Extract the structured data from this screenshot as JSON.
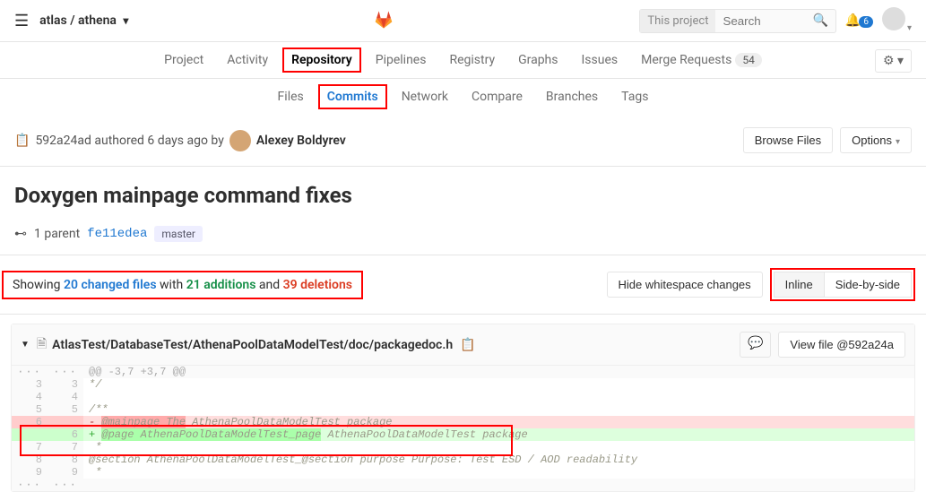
{
  "breadcrumb": {
    "group": "atlas",
    "project": "athena"
  },
  "search": {
    "scope": "This project",
    "placeholder": "Search"
  },
  "todos_count": "6",
  "nav1": {
    "project": "Project",
    "activity": "Activity",
    "repository": "Repository",
    "pipelines": "Pipelines",
    "registry": "Registry",
    "graphs": "Graphs",
    "issues": "Issues",
    "merge_requests": "Merge Requests",
    "mr_count": "54"
  },
  "nav2": {
    "files": "Files",
    "commits": "Commits",
    "network": "Network",
    "compare": "Compare",
    "branches": "Branches",
    "tags": "Tags"
  },
  "commit": {
    "sha": "592a24ad",
    "auth_text": "authored 6 days ago by",
    "author": "Alexey Boldyrev",
    "browse": "Browse Files",
    "options": "Options",
    "title": "Doxygen mainpage command fixes",
    "parents_label": "1 parent",
    "parent_sha": "fe11edea",
    "branch": "master"
  },
  "summary": {
    "prefix": "Showing",
    "changed": "20 changed files",
    "with": "with",
    "adds": "21 additions",
    "and": "and",
    "dels": "39 deletions",
    "hide_ws": "Hide whitespace changes",
    "inline": "Inline",
    "sbs": "Side-by-side"
  },
  "file": {
    "path": "AtlasTest/DatabaseTest/AthenaPoolDataModelTest/doc/packagedoc.h",
    "view_btn": "View file @592a24a",
    "hunk": "@@ -3,7 +3,7 @@",
    "l3": "*/",
    "l5": "/**",
    "del_line_old": "6",
    "del_text_a": "@mainpage The",
    "del_text_b": " AthenaPoolDataModelTest package",
    "add_line_new": "6",
    "add_text_a": "@page AthenaPoolDataModelTest_page",
    "add_text_b": " AthenaPoolDataModelTest package",
    "l7": " *",
    "l8": "@section AthenaPoolDataModelTest_@section purpose Purpose: Test ESD / AOD readability",
    "l9": " *"
  }
}
